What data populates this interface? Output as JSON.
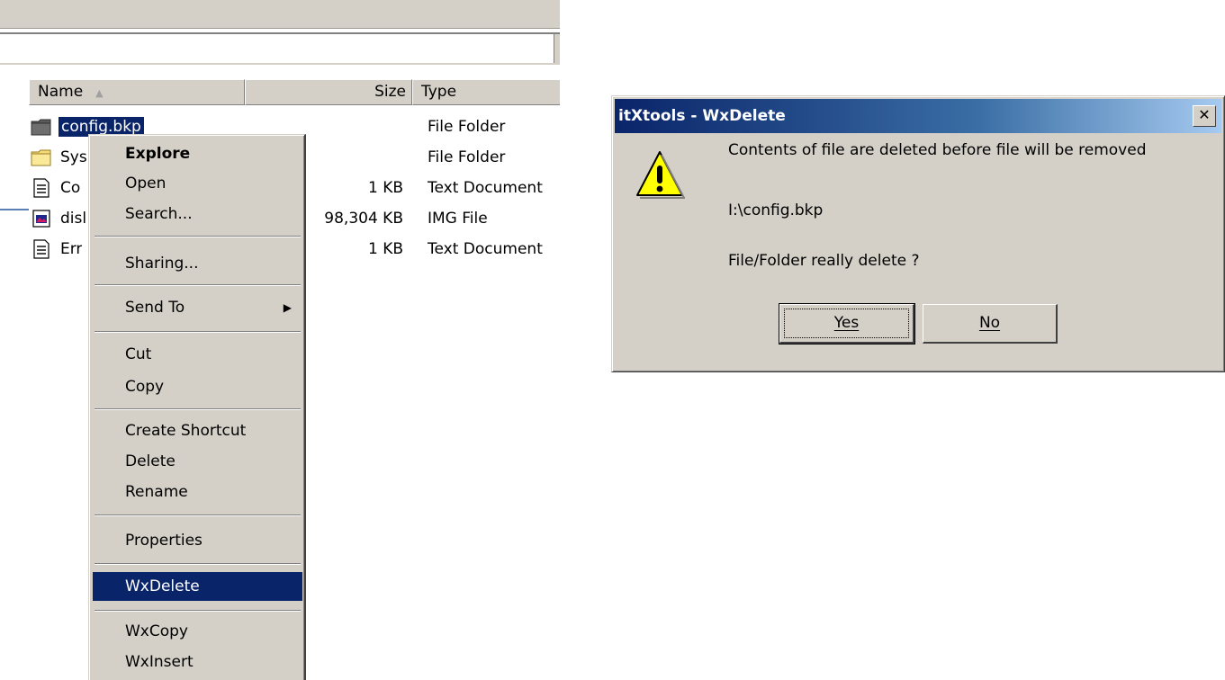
{
  "explorer": {
    "columns": {
      "name": "Name",
      "size": "Size",
      "type": "Type"
    },
    "rows": [
      {
        "name": "config.bkp",
        "size": "",
        "type": "File Folder",
        "icon": "folder-dark-icon"
      },
      {
        "name": "Sys",
        "size": "",
        "type": "File Folder",
        "icon": "folder-icon"
      },
      {
        "name": "Co",
        "size": "1 KB",
        "type": "Text Document",
        "icon": "text-document-icon"
      },
      {
        "name": "disl",
        "size": "98,304 KB",
        "type": "IMG File",
        "icon": "img-file-icon"
      },
      {
        "name": "Err",
        "size": "1 KB",
        "type": "Text Document",
        "icon": "text-document-icon"
      }
    ]
  },
  "context_menu": {
    "items": [
      "Explore",
      "Open",
      "Search...",
      "Sharing...",
      "Send To",
      "Cut",
      "Copy",
      "Create Shortcut",
      "Delete",
      "Rename",
      "Properties",
      "WxDelete",
      "WxCopy",
      "WxInsert"
    ],
    "highlighted": "WxDelete"
  },
  "dialog": {
    "title": "itXtools - WxDelete",
    "message": "Contents of file are deleted before file will be  removed",
    "path": "I:\\config.bkp",
    "question": "File/Folder really delete ?",
    "yes_label": "Yes",
    "no_label": "No",
    "close_glyph": "✕"
  },
  "colors": {
    "selection": "#0a246a",
    "face": "#d4d0c8"
  }
}
